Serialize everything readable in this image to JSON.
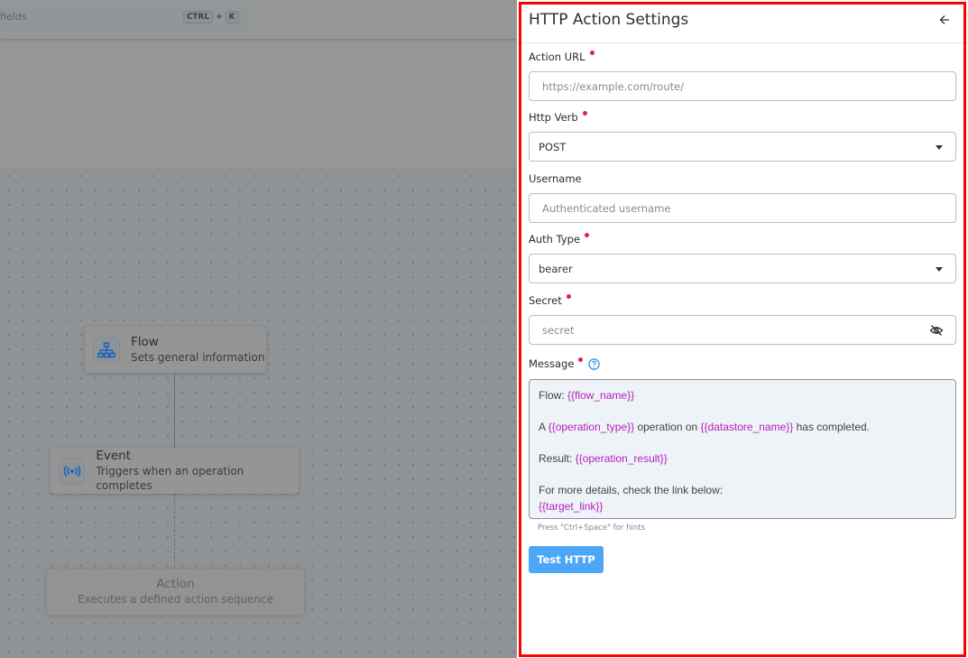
{
  "topbar": {
    "search_placeholder_fragment": "fields",
    "shortcut_keys": [
      "CTRL",
      "K"
    ],
    "shortcut_separator": "+"
  },
  "canvas": {
    "nodes": [
      {
        "title": "Flow",
        "subtitle": "Sets general information",
        "icon": "sitemap-icon"
      },
      {
        "title": "Event",
        "subtitle": "Triggers when an operation completes",
        "icon": "broadcast-icon"
      },
      {
        "title": "Action",
        "subtitle": "Executes a defined action sequence",
        "icon": null
      }
    ]
  },
  "panel": {
    "title": "HTTP Action Settings",
    "back_icon": "arrow-left-icon",
    "fields": {
      "action_url": {
        "label": "Action URL",
        "required": true,
        "value": "",
        "placeholder": "https://example.com/route/"
      },
      "http_verb": {
        "label": "Http Verb",
        "required": true,
        "value": "POST"
      },
      "username": {
        "label": "Username",
        "required": false,
        "value": "",
        "placeholder": "Authenticated username"
      },
      "auth_type": {
        "label": "Auth Type",
        "required": true,
        "value": "bearer"
      },
      "secret": {
        "label": "Secret",
        "required": true,
        "value": "",
        "placeholder": "secret",
        "toggle_icon": "eye-off-icon"
      },
      "message": {
        "label": "Message",
        "required": true,
        "help_icon": "question-circle-icon",
        "lines": [
          [
            {
              "t": "Flow: "
            },
            {
              "v": "{{flow_name}}"
            }
          ],
          [],
          [
            {
              "t": "A "
            },
            {
              "v": "{{operation_type}}"
            },
            {
              "t": " operation on "
            },
            {
              "v": "{{datastore_name}}"
            },
            {
              "t": " has completed."
            }
          ],
          [],
          [
            {
              "t": "Result: "
            },
            {
              "v": "{{operation_result}}"
            }
          ],
          [],
          [
            {
              "t": "For more details, check the link below:"
            }
          ],
          [
            {
              "v": "{{target_link}}"
            }
          ]
        ],
        "hint": "Press \"Ctrl+Space\" for hints"
      }
    },
    "test_button_label": "Test HTTP"
  },
  "colors": {
    "accent": "#4ea6f6",
    "required_dot": "#e5195f",
    "template_variable": "#b520c0",
    "highlight_border": "#ff0000",
    "node_icon": "#1f62b8"
  }
}
